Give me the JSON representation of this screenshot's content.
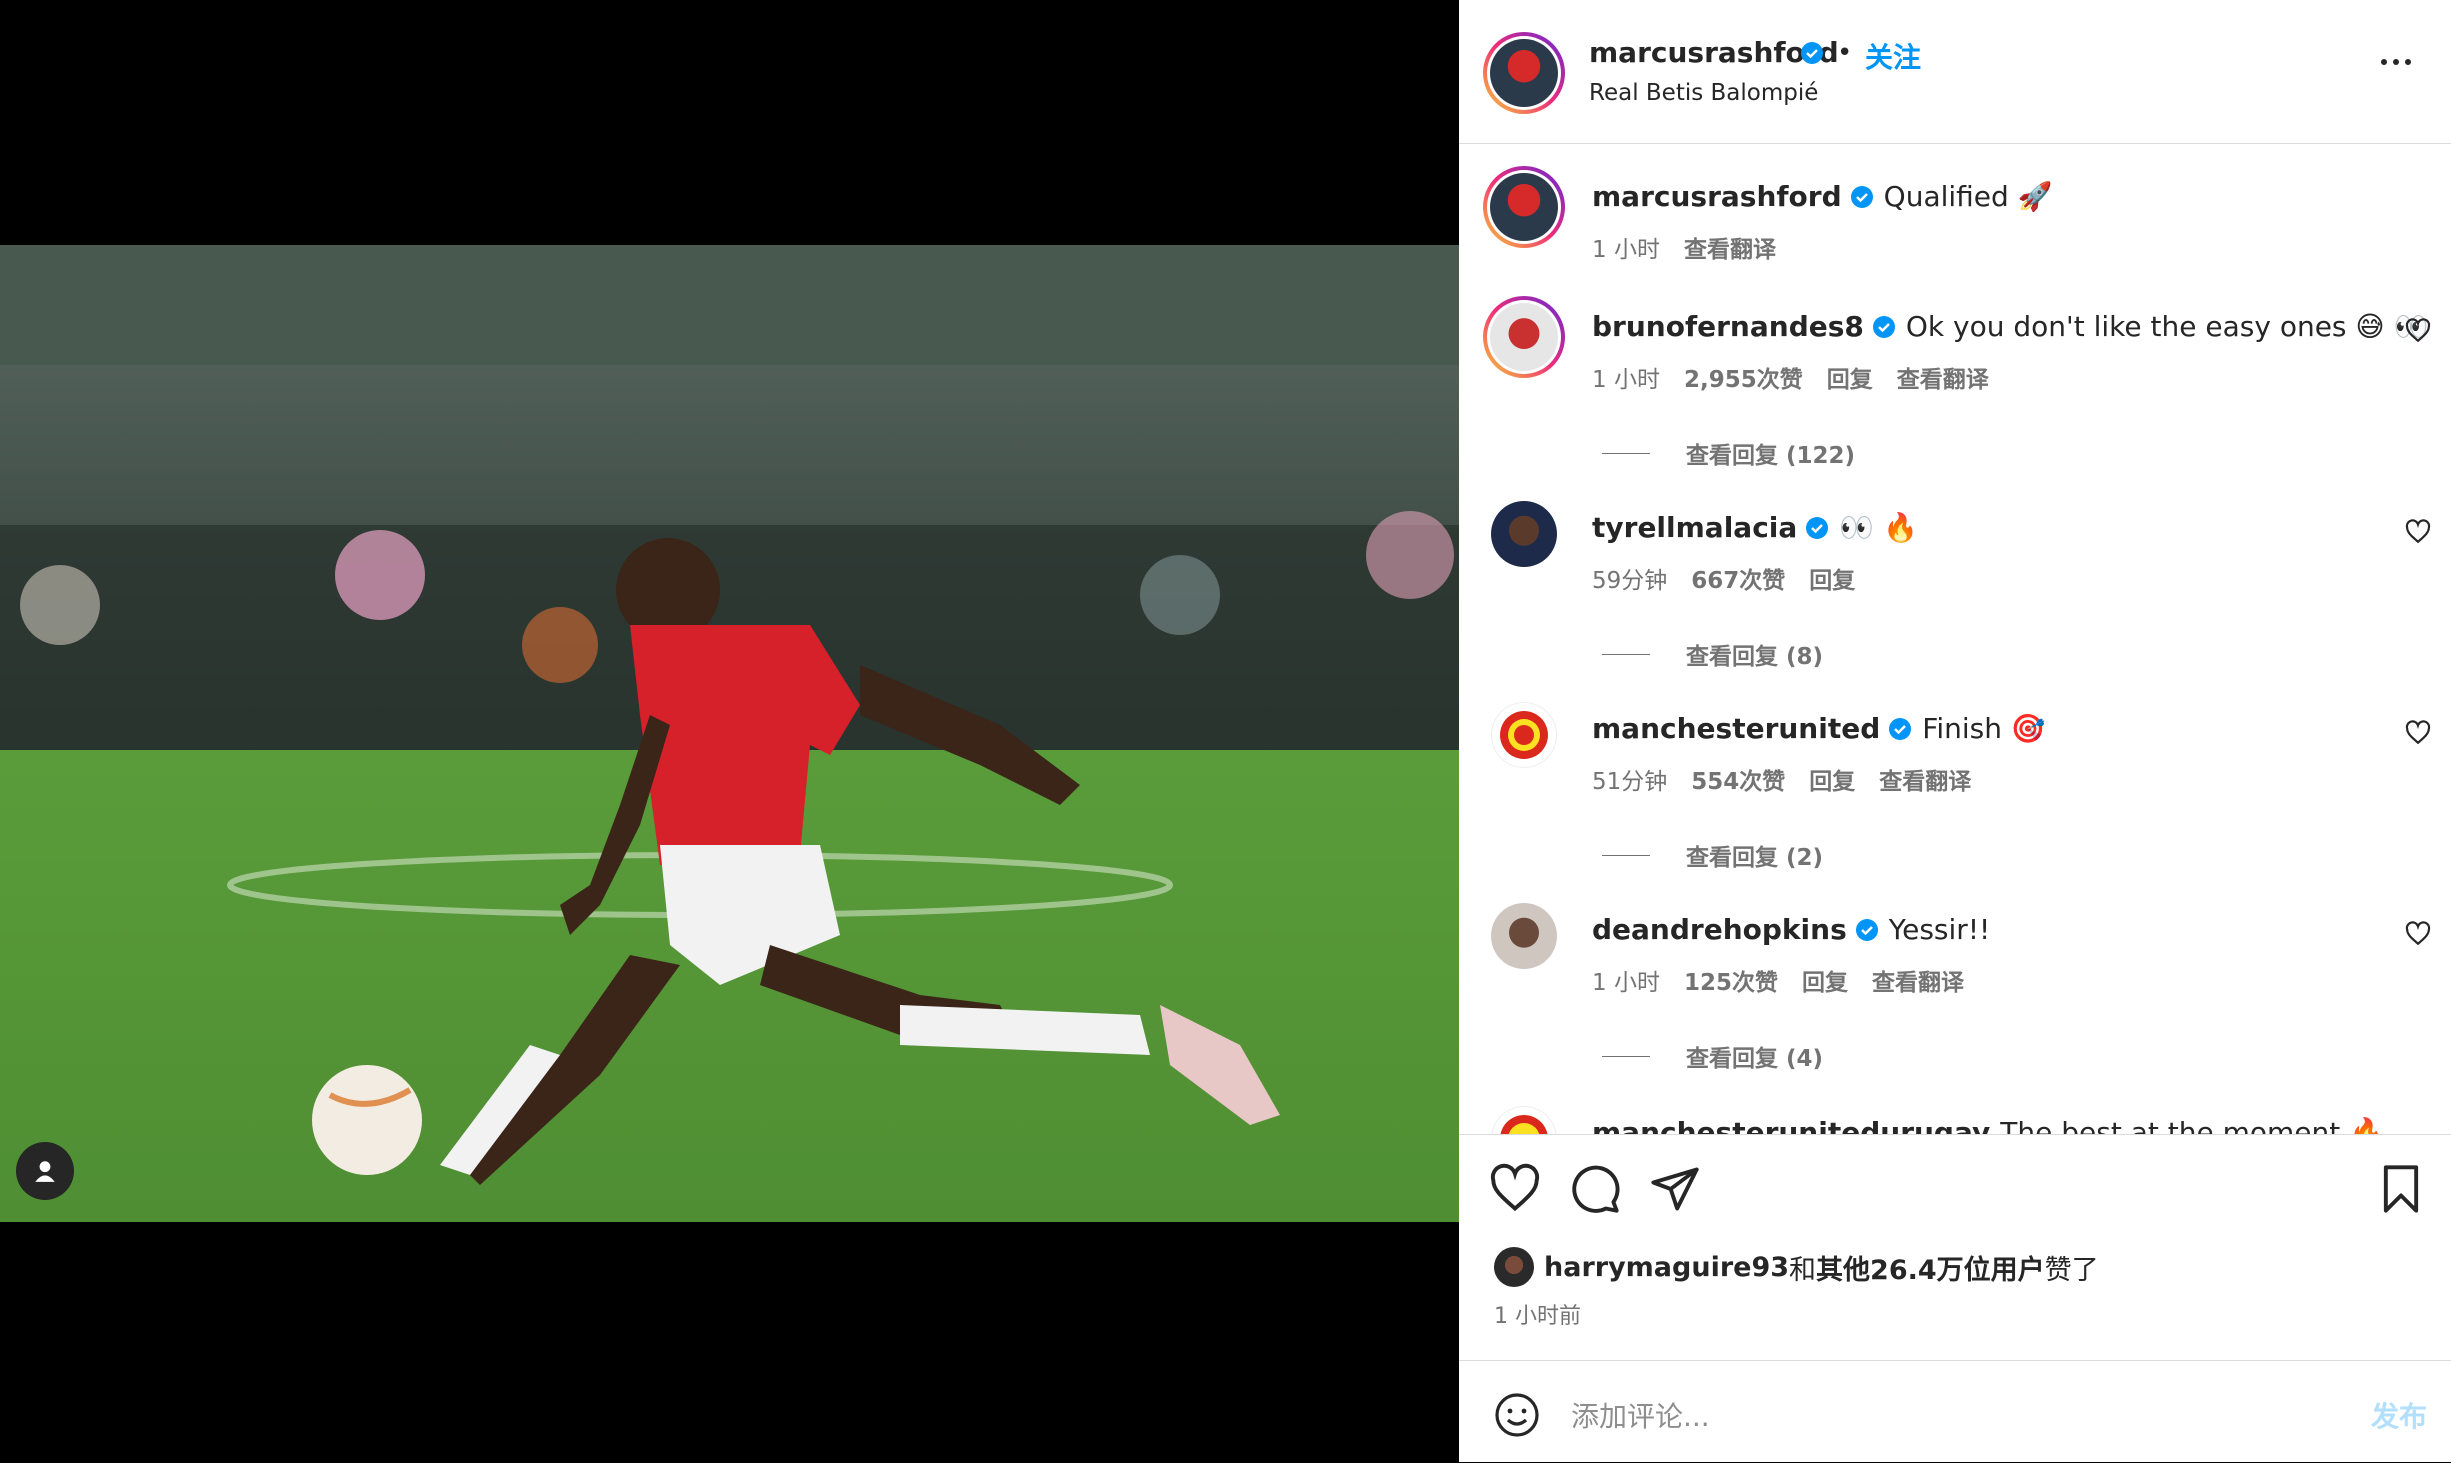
{
  "post": {
    "author": "marcusrashford",
    "location": "Real Betis Balompié",
    "dot": "•",
    "follow_label": "关注"
  },
  "caption": {
    "username": "marcusrashford",
    "text": "Qualified 🚀",
    "time": "1 小时",
    "translate": "查看翻译"
  },
  "comments": [
    {
      "username": "brunofernandes8",
      "text": "Ok you don't like the easy ones 😅 👀",
      "time": "1 小时",
      "likes": "2,955次赞",
      "reply": "回复",
      "translate": "查看翻译",
      "view_replies": "查看回复 (122)"
    },
    {
      "username": "tyrellmalacia",
      "text": "👀 🔥",
      "time": "59分钟",
      "likes": "667次赞",
      "reply": "回复",
      "translate": "",
      "view_replies": "查看回复 (8)"
    },
    {
      "username": "manchesterunited",
      "text": "Finish 🎯",
      "time": "51分钟",
      "likes": "554次赞",
      "reply": "回复",
      "translate": "查看翻译",
      "view_replies": "查看回复 (2)"
    },
    {
      "username": "deandrehopkins",
      "text": "Yessir!!",
      "time": "1 小时",
      "likes": "125次赞",
      "reply": "回复",
      "translate": "查看翻译",
      "view_replies": "查看回复 (4)"
    },
    {
      "username": "manchesterunitedurugay",
      "text": "The best at the moment 🔥"
    }
  ],
  "likes_line": {
    "user": "harrymaguire93",
    "middle": "和",
    "others": "其他26.4万位用户",
    "end": "赞了"
  },
  "posted_time": "1 小时前",
  "add_comment": {
    "placeholder": "添加评论...",
    "post_label": "发布"
  },
  "colors": {
    "accent": "#0095f6",
    "verified": "#0095f6",
    "post_disabled": "#b2dffc"
  }
}
